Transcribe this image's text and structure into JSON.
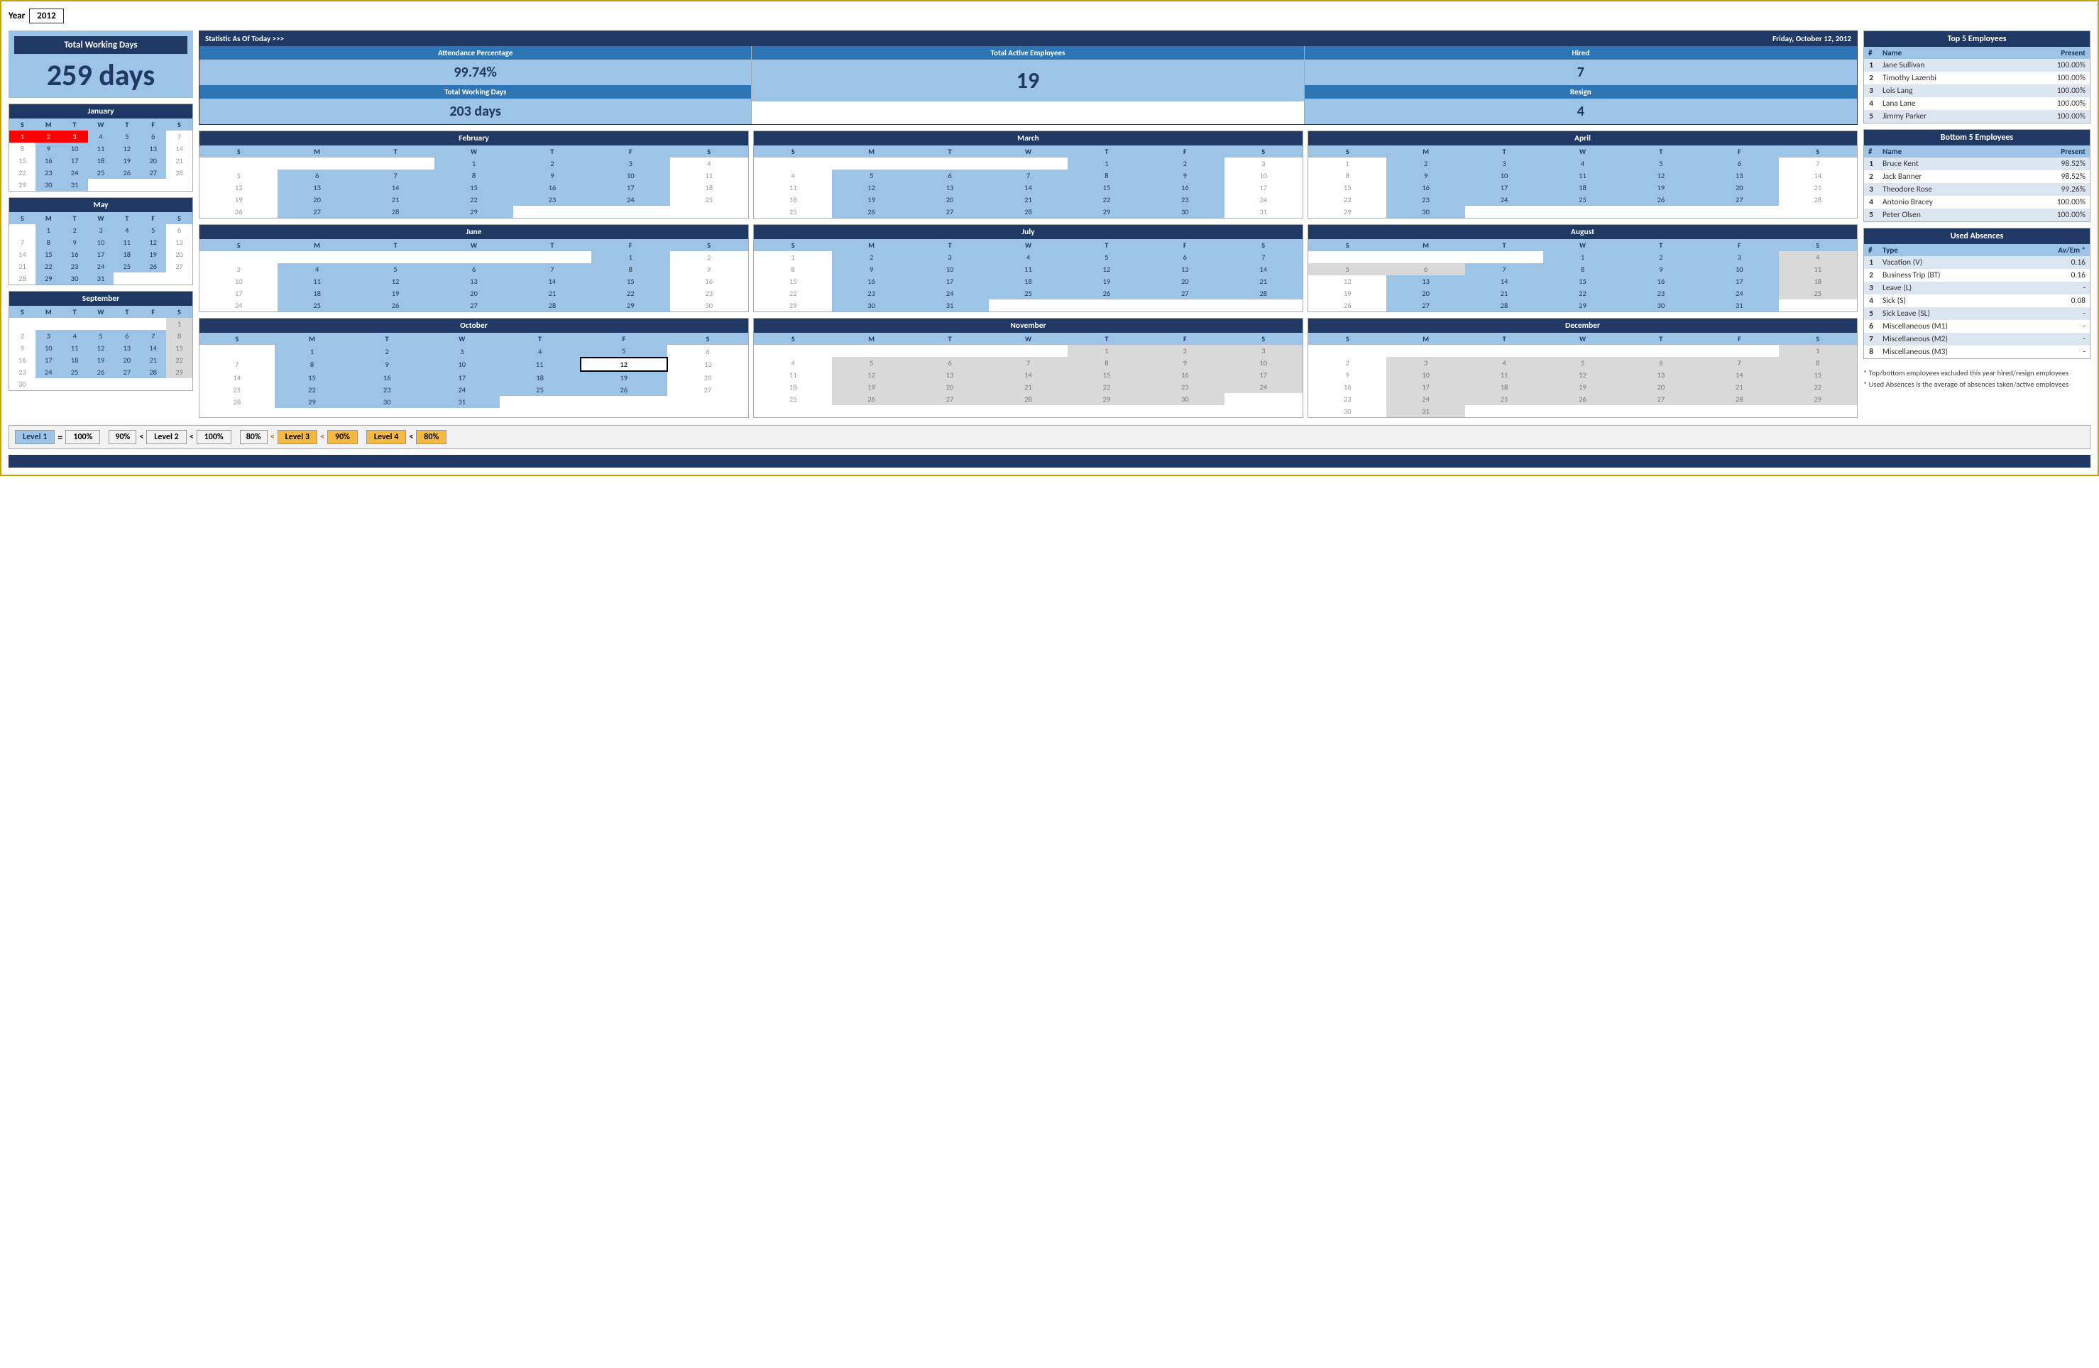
{
  "year_label": "Year",
  "year_value": "2012",
  "total_working_days": {
    "title": "Total Working Days",
    "value": "259 days"
  },
  "stats": {
    "header_left": "Statistic As Of Today   >>>",
    "header_right": "Friday, October 12, 2012",
    "attendance": {
      "label": "Attendance Percentage",
      "value": "99.74%",
      "working_days_label": "Total Working Days",
      "working_days_value": "203 days"
    },
    "active_employees": {
      "label": "Total Active Employees",
      "value": "19"
    },
    "hired": {
      "label": "Hired",
      "value": "7",
      "resign_label": "Resign",
      "resign_value": "4"
    }
  },
  "top5": {
    "title": "Top 5 Employees",
    "col_header": "Present",
    "rows": [
      {
        "rank": "1",
        "name": "Jane Sullivan",
        "value": "100.00%"
      },
      {
        "rank": "2",
        "name": "Timothy Lazenbi",
        "value": "100.00%"
      },
      {
        "rank": "3",
        "name": "Lois Lang",
        "value": "100.00%"
      },
      {
        "rank": "4",
        "name": "Lana Lane",
        "value": "100.00%"
      },
      {
        "rank": "5",
        "name": "Jimmy Parker",
        "value": "100.00%"
      }
    ]
  },
  "bottom5": {
    "title": "Bottom 5 Employees",
    "col_header": "Present",
    "rows": [
      {
        "rank": "1",
        "name": "Bruce Kent",
        "value": "98.52%"
      },
      {
        "rank": "2",
        "name": "Jack Banner",
        "value": "98.52%"
      },
      {
        "rank": "3",
        "name": "Theodore Rose",
        "value": "99.26%"
      },
      {
        "rank": "4",
        "name": "Antonio Bracey",
        "value": "100.00%"
      },
      {
        "rank": "5",
        "name": "Peter Olsen",
        "value": "100.00%"
      }
    ]
  },
  "used_absences": {
    "title": "Used Absences",
    "col_header": "Av/Em *",
    "rows": [
      {
        "rank": "1",
        "name": "Vacation (V)",
        "value": "0.16"
      },
      {
        "rank": "2",
        "name": "Business Trip (BT)",
        "value": "0.16"
      },
      {
        "rank": "3",
        "name": "Leave (L)",
        "value": "-"
      },
      {
        "rank": "4",
        "name": "Sick (S)",
        "value": "0.08"
      },
      {
        "rank": "5",
        "name": "Sick Leave (SL)",
        "value": "-"
      },
      {
        "rank": "6",
        "name": "Miscellaneous (M1)",
        "value": "-"
      },
      {
        "rank": "7",
        "name": "Miscellaneous (M2)",
        "value": "-"
      },
      {
        "rank": "8",
        "name": "Miscellaneous (M3)",
        "value": "-"
      }
    ]
  },
  "footnote1": "* Top/bottom employees excluded this year hired/resign employees",
  "footnote2": "* Used Absences is the average of absences taken/active employees",
  "legend": [
    {
      "label": "Level 1",
      "eq": "=",
      "value": "100%",
      "color": "#9dc3e6",
      "text_color": "#1f3864"
    },
    {
      "label": "90%",
      "lt": "<",
      "mid": "Level 2",
      "lt2": "<",
      "value": "100%",
      "color": "#fff",
      "text_color": "#333"
    },
    {
      "label": "80%",
      "lt": "<",
      "mid": "Level 3",
      "lt2": "<",
      "value": "90%",
      "color": "#f4b942",
      "text_color": "#333"
    },
    {
      "label": "Level 4",
      "lt": "<",
      "value": "80%",
      "color": "#f4b942",
      "text_color": "#333"
    }
  ]
}
